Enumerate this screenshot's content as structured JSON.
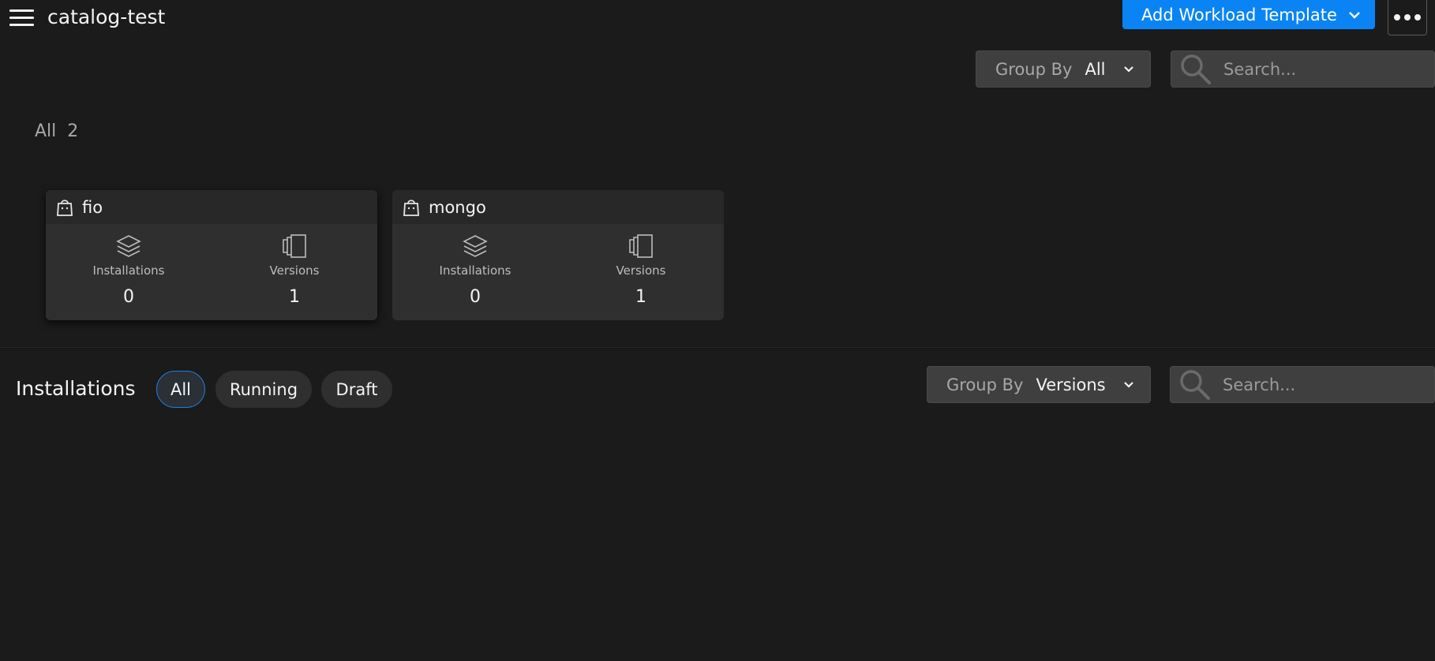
{
  "header": {
    "title": "catalog-test",
    "add_button_label": "Add Workload Template"
  },
  "templates": {
    "group_by": {
      "label": "Group By",
      "value": "All"
    },
    "search": {
      "placeholder": "Search..."
    },
    "count": {
      "label": "All",
      "value": "2"
    },
    "cards": [
      {
        "name": "fio",
        "installations_label": "Installations",
        "installations": "0",
        "versions_label": "Versions",
        "versions": "1"
      },
      {
        "name": "mongo",
        "installations_label": "Installations",
        "installations": "0",
        "versions_label": "Versions",
        "versions": "1"
      }
    ]
  },
  "installations": {
    "title": "Installations",
    "filters": [
      "All",
      "Running",
      "Draft"
    ],
    "active_filter": "All",
    "group_by": {
      "label": "Group By",
      "value": "Versions"
    },
    "search": {
      "placeholder": "Search..."
    }
  },
  "colors": {
    "accent": "#0a84f5",
    "background": "#1b1b1b",
    "card": "#2f2f2f"
  },
  "icons": [
    "menu-icon",
    "chevron-down-icon",
    "more-icon",
    "search-icon",
    "template-icon",
    "layers-icon",
    "versions-icon"
  ]
}
